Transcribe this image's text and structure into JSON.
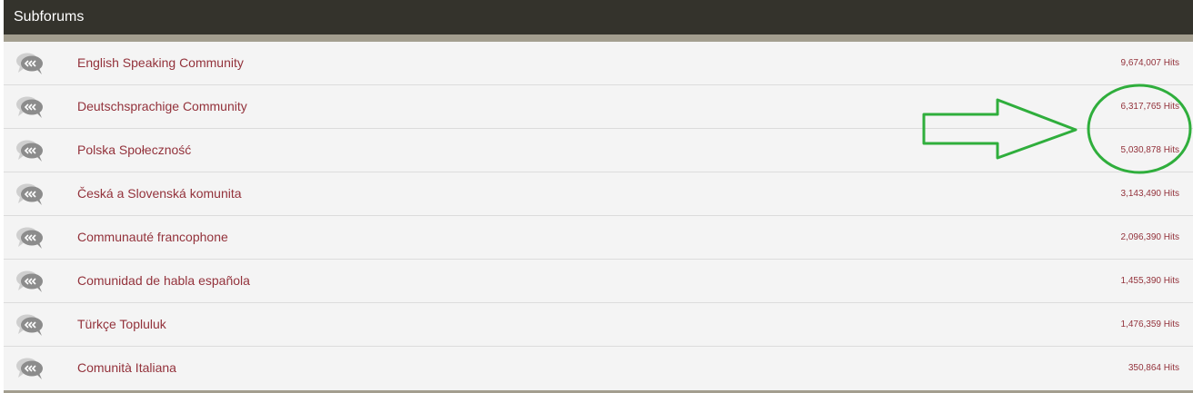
{
  "header": {
    "title": "Subforums"
  },
  "subforums": [
    {
      "name": "English Speaking Community",
      "hits": "9,674,007 Hits"
    },
    {
      "name": "Deutschsprachige Community",
      "hits": "6,317,765 Hits"
    },
    {
      "name": "Polska Społeczność",
      "hits": "5,030,878 Hits"
    },
    {
      "name": "Česká a Slovenská komunita",
      "hits": "3,143,490 Hits"
    },
    {
      "name": "Communauté francophone",
      "hits": "2,096,390 Hits"
    },
    {
      "name": "Comunidad de habla española",
      "hits": "1,455,390 Hits"
    },
    {
      "name": "Türkçe Topluluk",
      "hits": "1,476,359 Hits"
    },
    {
      "name": "Comunità Italiana",
      "hits": "350,864 Hits"
    }
  ],
  "icons": {
    "row_icon": "speech-bubbles-icon",
    "annotation_arrow": "arrow-right-icon",
    "annotation_circle": "circle-highlight"
  },
  "colors": {
    "header_bg": "#34332c",
    "header_rule": "#a39e8f",
    "link": "#93323b",
    "annotation": "#2fae3c"
  }
}
